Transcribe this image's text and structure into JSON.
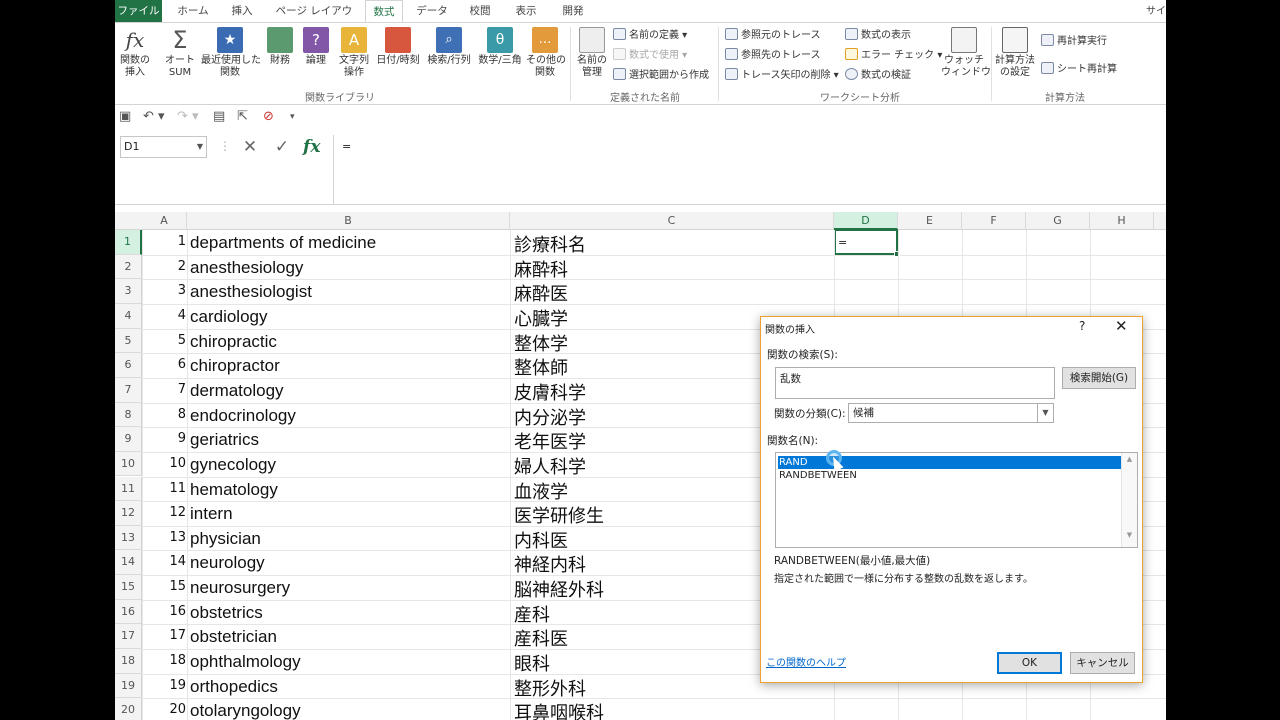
{
  "ribbon_tabs": [
    "ファイル",
    "ホーム",
    "挿入",
    "ページ レイアウト",
    "数式",
    "データ",
    "校閲",
    "表示",
    "開発"
  ],
  "window_partial": "サイ",
  "ribbon": {
    "insert_function": "関数の\n挿入",
    "autosum": "オート\nSUM",
    "recent": "最近使用した\n関数",
    "financial": "財務",
    "logical": "論理",
    "text": "文字列\n操作",
    "datetime": "日付/時刻",
    "lookup": "検索/行列",
    "math": "数学/三角",
    "more": "その他の\n関数",
    "group_library": "関数ライブラリ",
    "name_manager": "名前の\n管理",
    "define_name": "名前の定義",
    "use_in_formula": "数式で使用",
    "create_from_selection": "選択範囲から作成",
    "group_names": "定義された名前",
    "trace_precedents": "参照元のトレース",
    "trace_dependents": "参照先のトレース",
    "remove_arrows": "トレース矢印の削除",
    "show_formulas": "数式の表示",
    "error_checking": "エラー チェック",
    "evaluate_formula": "数式の検証",
    "watch_window": "ウォッチ\nウィンドウ",
    "group_audit": "ワークシート分析",
    "calc_options": "計算方法\nの設定",
    "calc_now": "再計算実行",
    "calc_sheet": "シート再計算",
    "group_calc": "計算方法"
  },
  "namebox": "D1",
  "formula": "=",
  "columns": [
    "A",
    "B",
    "C",
    "D",
    "E",
    "F",
    "G",
    "H"
  ],
  "rows": [
    {
      "n": "1",
      "a": "1",
      "b": "departments of medicine",
      "c": "診療科名"
    },
    {
      "n": "2",
      "a": "2",
      "b": "anesthesiology",
      "c": "麻酔科"
    },
    {
      "n": "3",
      "a": "3",
      "b": "anesthesiologist",
      "c": "麻酔医"
    },
    {
      "n": "4",
      "a": "4",
      "b": "cardiology",
      "c": "心臓学"
    },
    {
      "n": "5",
      "a": "5",
      "b": "chiropractic",
      "c": "整体学"
    },
    {
      "n": "6",
      "a": "6",
      "b": "chiropractor",
      "c": "整体師"
    },
    {
      "n": "7",
      "a": "7",
      "b": "dermatology",
      "c": "皮膚科学"
    },
    {
      "n": "8",
      "a": "8",
      "b": "endocrinology",
      "c": "内分泌学"
    },
    {
      "n": "9",
      "a": "9",
      "b": "geriatrics",
      "c": "老年医学"
    },
    {
      "n": "10",
      "a": "10",
      "b": "gynecology",
      "c": "婦人科学"
    },
    {
      "n": "11",
      "a": "11",
      "b": "hematology",
      "c": "血液学"
    },
    {
      "n": "12",
      "a": "12",
      "b": "intern",
      "c": "医学研修生"
    },
    {
      "n": "13",
      "a": "13",
      "b": "physician",
      "c": "内科医"
    },
    {
      "n": "14",
      "a": "14",
      "b": "neurology",
      "c": "神経内科"
    },
    {
      "n": "15",
      "a": "15",
      "b": "neurosurgery",
      "c": "脳神経外科"
    },
    {
      "n": "16",
      "a": "16",
      "b": "obstetrics",
      "c": "産科"
    },
    {
      "n": "17",
      "a": "17",
      "b": "obstetrician",
      "c": "産科医"
    },
    {
      "n": "18",
      "a": "18",
      "b": "ophthalmology",
      "c": "眼科"
    },
    {
      "n": "19",
      "a": "19",
      "b": "orthopedics",
      "c": "整形外科"
    },
    {
      "n": "20",
      "a": "20",
      "b": "otolaryngology",
      "c": "耳鼻咽喉科"
    }
  ],
  "active_cell_value": "=",
  "dialog": {
    "title": "関数の挿入",
    "help": "?",
    "close": "✕",
    "search_label": "関数の検索(S):",
    "search_value": "乱数",
    "search_button": "検索開始(G)",
    "category_label": "関数の分類(C):",
    "category_value": "候補",
    "fn_label": "関数名(N):",
    "functions": [
      "RAND",
      "RANDBETWEEN"
    ],
    "selected_function": "RAND",
    "syntax": "RANDBETWEEN(最小値,最大値)",
    "description": "指定された範囲で一様に分布する整数の乱数を返します。",
    "help_link": "この関数のヘルプ",
    "ok": "OK",
    "cancel": "キャンセル"
  },
  "colors": {
    "excel_green": "#217346",
    "selection_blue": "#0078d7"
  }
}
